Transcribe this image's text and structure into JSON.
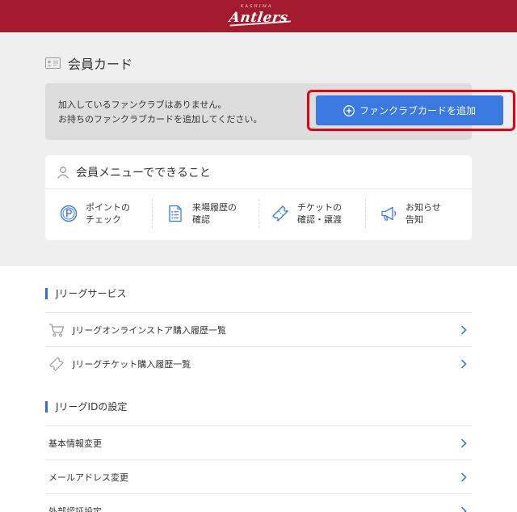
{
  "header": {
    "logo_small": "KASHIMA",
    "logo": "Antlers"
  },
  "member_card": {
    "title": "会員カード",
    "notice_line1": "加入しているファンクラブはありません。",
    "notice_line2": "お持ちのファンクラブカードを追加してください。",
    "add_button_label": "ファンクラブカードを追加"
  },
  "member_menu": {
    "title": "会員メニューでできること",
    "features": [
      {
        "label": "ポイントの\nチェック",
        "icon": "point-icon"
      },
      {
        "label": "来場履歴の\n確認",
        "icon": "list-icon"
      },
      {
        "label": "チケットの\n確認・譲渡",
        "icon": "ticket-icon"
      },
      {
        "label": "お知らせ\n告知",
        "icon": "megaphone-icon"
      }
    ]
  },
  "jleague_services": {
    "title": "Jリーグサービス",
    "items": [
      {
        "label": "Jリーグオンラインストア購入履歴一覧",
        "icon": "cart-icon"
      },
      {
        "label": "Jリーグチケット購入履歴一覧",
        "icon": "ticket-icon"
      }
    ]
  },
  "jleague_id": {
    "title": "JリーグIDの設定",
    "items": [
      {
        "label": "基本情報変更"
      },
      {
        "label": "メールアドレス変更"
      },
      {
        "label": "外部認証設定"
      }
    ]
  },
  "colors": {
    "header": "#a31a2e",
    "accent": "#3a7ae0",
    "highlight": "#e60012",
    "section_bar": "#2d6fd6"
  }
}
